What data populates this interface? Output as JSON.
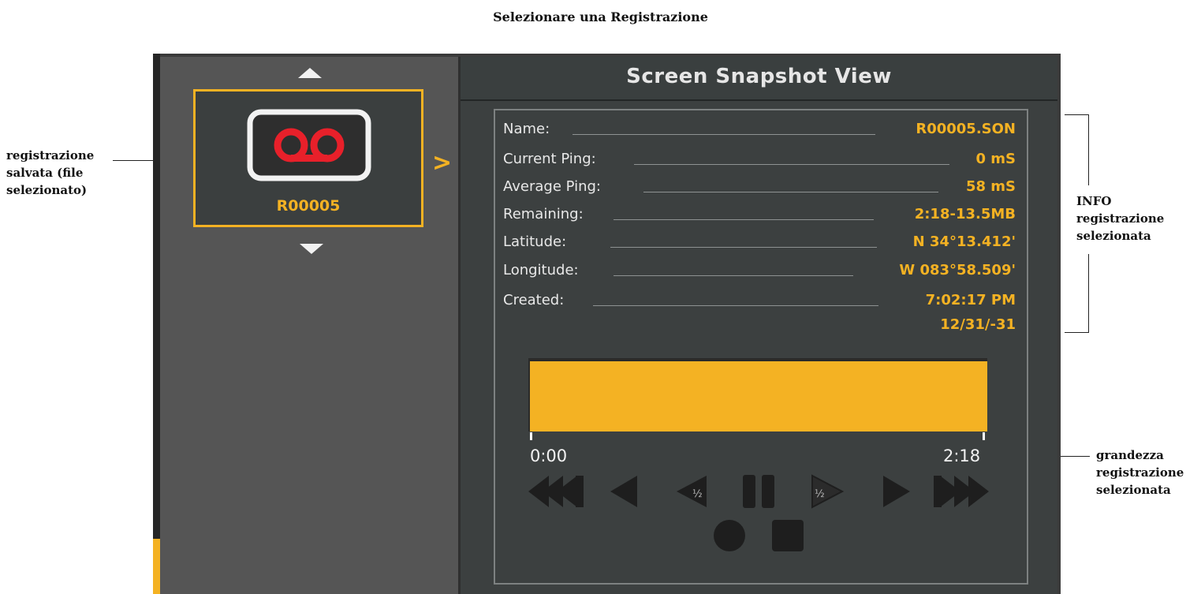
{
  "page_title": "Selezionare una Registrazione",
  "callouts": {
    "saved_recording": "registrazione salvata (file selezionato)",
    "selected_info": "INFO registrazione selezionata",
    "recording_size": "grandezza registrazione selezionata"
  },
  "header": {
    "title": "Screen Snapshot View"
  },
  "file_tile": {
    "name": "R00005",
    "icon": "voicemail-tape-icon"
  },
  "info": {
    "name": {
      "label": "Name:",
      "value": "R00005.SON"
    },
    "current_ping": {
      "label": "Current Ping:",
      "value": "0 mS"
    },
    "average_ping": {
      "label": "Average Ping:",
      "value": "58 mS"
    },
    "remaining": {
      "label": "Remaining:",
      "value": "2:18-13.5MB"
    },
    "latitude": {
      "label": "Latitude:",
      "value": "N 34°13.412'"
    },
    "longitude": {
      "label": "Longitude:",
      "value": "W 083°58.509'"
    },
    "created": {
      "label": "Created:",
      "value": "7:02:17 PM",
      "value_line2": "12/31/-31"
    }
  },
  "playback": {
    "start_time": "0:00",
    "end_time": "2:18",
    "progress": 1.0
  },
  "colors": {
    "accent": "#f4b223",
    "panel_dark": "#3c4040",
    "list_bg": "#555555",
    "tape_red": "#e8202a"
  }
}
